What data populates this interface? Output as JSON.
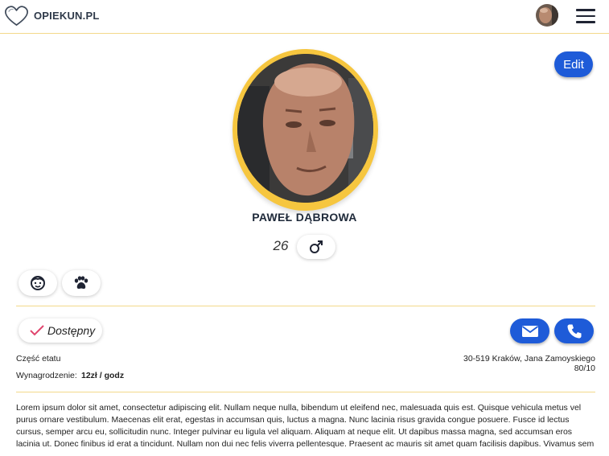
{
  "header": {
    "logo_text": "OPIEKUN.PL"
  },
  "profile": {
    "edit_label": "Edit",
    "name": "PAWEŁ DĄBROWA",
    "age": "26",
    "gender_icon": "male-icon",
    "care_icons": [
      "child-face-icon",
      "paw-icon"
    ]
  },
  "status": {
    "availability": "Dostępny",
    "employment": "Część etatu",
    "salary_label": "Wynagrodzenie:",
    "salary_value": "12zł / godz",
    "address": "30-519 Kraków, Jana Zamoyskiego 80/10"
  },
  "description": "Lorem ipsum dolor sit amet, consectetur adipiscing elit. Nullam neque nulla, bibendum ut eleifend nec, malesuada quis est. Quisque vehicula metus vel purus ornare vestibulum. Maecenas elit erat, egestas in accumsan quis, luctus a magna. Nunc lacinia risus gravida congue posuere. Fusce id lectus cursus, semper arcu eu, sollicitudin nunc. Integer pulvinar eu ligula vel aliquam. Aliquam at neque elit. Ut dapibus massa magna, sed accumsan eros lacinia ut. Donec finibus id erat a tincidunt. Nullam non dui nec felis viverra pellentesque. Praesent ac mauris sit amet quam facilisis dapibus. Vivamus sem",
  "colors": {
    "accent": "#1e5bd8",
    "gold": "#f6c63f",
    "divider": "#f3d98a",
    "check": "#e0466e"
  }
}
